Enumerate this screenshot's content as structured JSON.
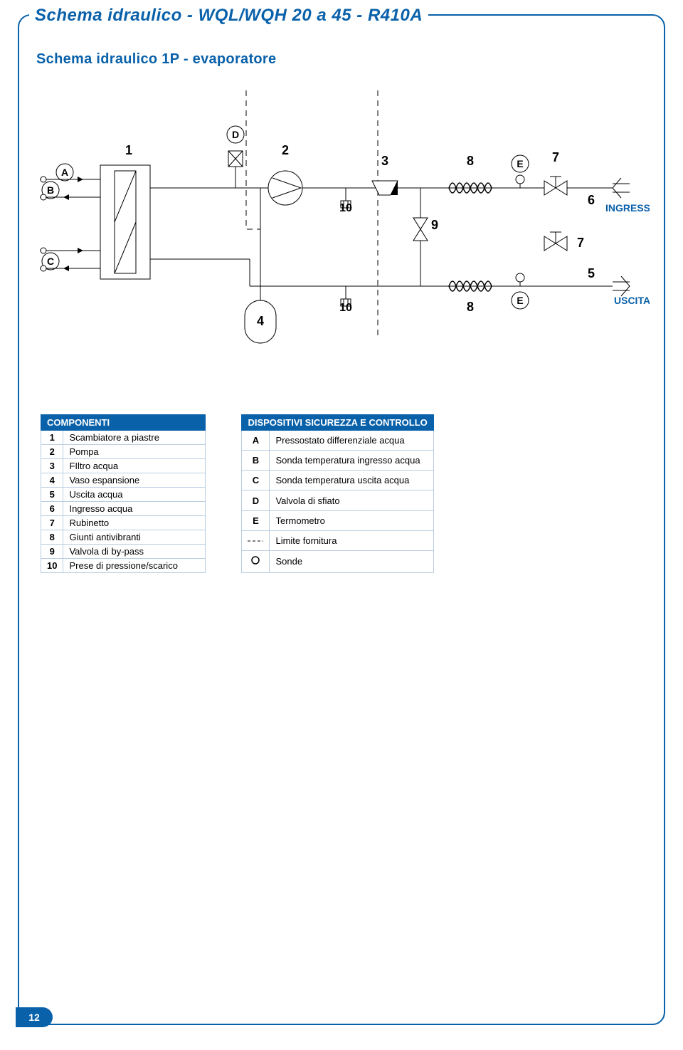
{
  "title": "Schema idraulico - WQL/WQH 20 a 45 - R410A",
  "subtitle": "Schema idraulico 1P - evaporatore",
  "page_number": "12",
  "diagram": {
    "labels": {
      "n1": "1",
      "n2": "2",
      "n3": "3",
      "n4": "4",
      "n5": "5",
      "n6": "6",
      "n7": "7",
      "n8": "8",
      "n9": "9",
      "n10": "10",
      "A": "A",
      "B": "B",
      "C": "C",
      "D": "D",
      "E": "E",
      "ingresso": "INGRESSO",
      "uscita": "USCITA"
    }
  },
  "componenti": {
    "header": "COMPONENTI",
    "rows": [
      {
        "k": "1",
        "v": "Scambiatore a piastre"
      },
      {
        "k": "2",
        "v": "Pompa"
      },
      {
        "k": "3",
        "v": "FIltro acqua"
      },
      {
        "k": "4",
        "v": "Vaso espansione"
      },
      {
        "k": "5",
        "v": "Uscita acqua"
      },
      {
        "k": "6",
        "v": "Ingresso acqua"
      },
      {
        "k": "7",
        "v": "Rubinetto"
      },
      {
        "k": "8",
        "v": "Giunti antivibranti"
      },
      {
        "k": "9",
        "v": "Valvola di by-pass"
      },
      {
        "k": "10",
        "v": "Prese di pressione/scarico"
      }
    ]
  },
  "dispositivi": {
    "header": "DISPOSITIVI SICUREZZA E CONTROLLO",
    "rows": [
      {
        "k": "A",
        "type": "text",
        "v": "Pressostato differenziale acqua"
      },
      {
        "k": "B",
        "type": "text",
        "v": "Sonda temperatura ingresso acqua"
      },
      {
        "k": "C",
        "type": "text",
        "v": "Sonda temperatura uscita acqua"
      },
      {
        "k": "D",
        "type": "text",
        "v": "Valvola di sfiato"
      },
      {
        "k": "E",
        "type": "text",
        "v": "Termometro"
      },
      {
        "k": "dashes",
        "type": "icon",
        "v": "Limite fornitura"
      },
      {
        "k": "circle",
        "type": "icon",
        "v": "Sonde"
      }
    ]
  }
}
